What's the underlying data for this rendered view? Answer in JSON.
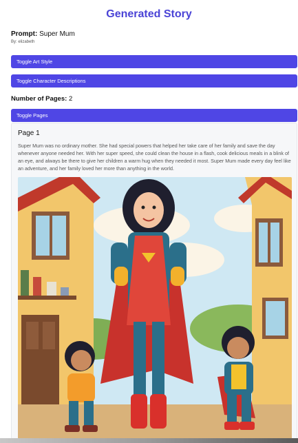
{
  "header": {
    "title": "Generated Story"
  },
  "prompt": {
    "label": "Prompt:",
    "value": "Super Mum",
    "byline": "By: elizabeth"
  },
  "toggles": {
    "art_style": "Toggle Art Style",
    "character_descriptions": "Toggle Character Descriptions",
    "pages": "Toggle Pages"
  },
  "pages_info": {
    "label": "Number of Pages:",
    "value": "2"
  },
  "page": {
    "title": "Page 1",
    "text": "Super Mum was no ordinary mother. She had special powers that helped her take care of her family and save the day whenever anyone needed her. With her super speed, she could clean the house in a flash, cook delicious meals in a blink of an eye, and always be there to give her children a warm hug when they needed it most. Super Mum made every day feel like an adventure, and her family loved her more than anything in the world."
  },
  "colors": {
    "accent": "#4f46e5",
    "title": "#4a43d6"
  }
}
